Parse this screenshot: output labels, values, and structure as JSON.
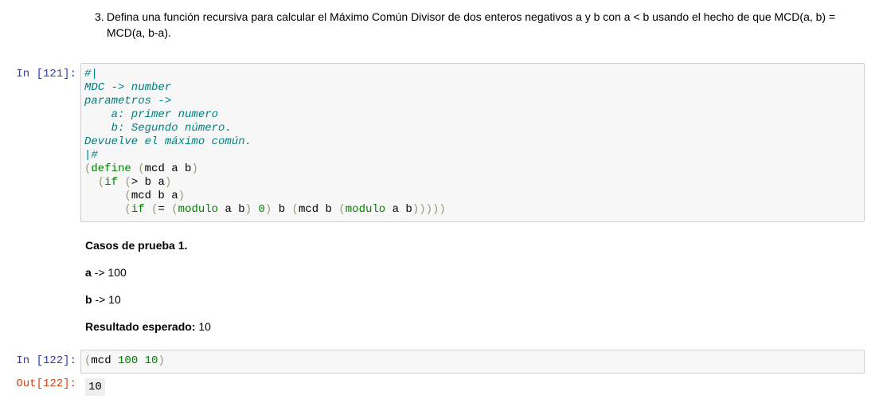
{
  "exercise": {
    "number": "3.",
    "text": "Defina una función recursiva para calcular el Máximo Común Divisor de dos enteros negativos a y b con a < b usando el hecho de que MCD(a, b) = MCD(a, b-a)."
  },
  "cell1": {
    "prompt": "In [121]:",
    "comment_lines": [
      "#|",
      "MDC -> number",
      "parametros ->",
      "    a: primer numero",
      "    b: Segundo número.",
      "Devuelve el máximo común.",
      "|#"
    ],
    "code": {
      "define_kw": "define",
      "head": "mcd a b",
      "if1_kw": "if",
      "cond": "> b a",
      "mcd_call": "mcd b a",
      "if2_kw": "if",
      "eq": "= ",
      "modulo1": "modulo",
      "modulo1_args": " a b",
      "zero": "0",
      "mid": " b ",
      "mcd2": "mcd b ",
      "modulo2": "modulo",
      "modulo2_args": " a b"
    }
  },
  "test_case": {
    "title": "Casos de prueba 1.",
    "a_label": "a",
    "a_value": " -> 100",
    "b_label": "b",
    "b_value": " -> 10",
    "expected_label": "Resultado esperado:",
    "expected_value": " 10"
  },
  "cell2": {
    "prompt": "In [122]:",
    "fn": "mcd",
    "arg1": "100",
    "arg2": "10",
    "out_prompt": "Out[122]:",
    "output": "10"
  }
}
